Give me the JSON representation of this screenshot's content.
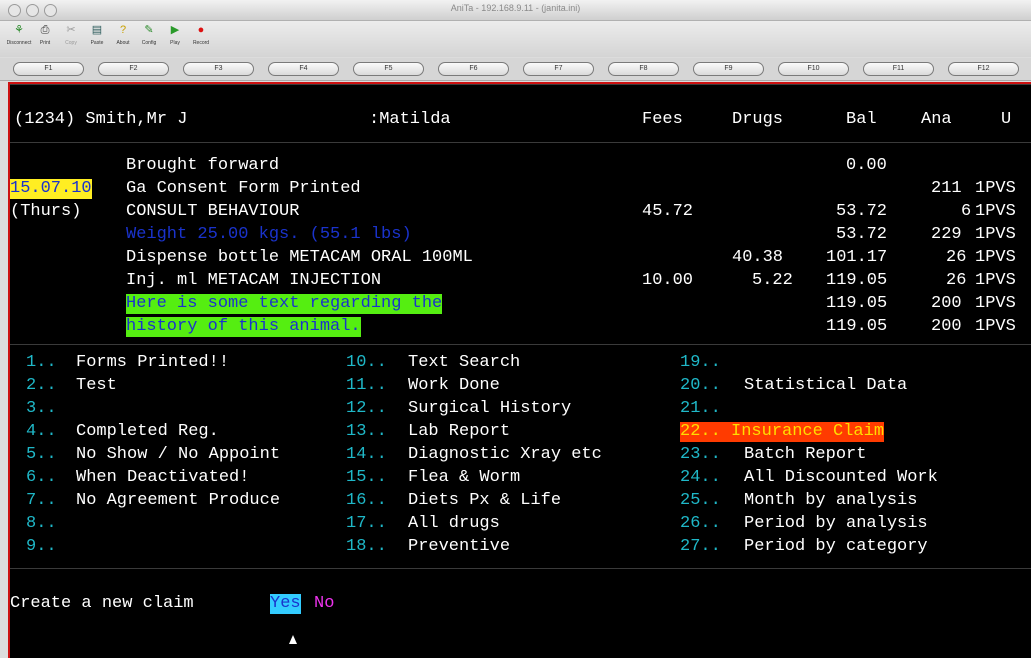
{
  "window": {
    "title": "AniTa - 192.168.9.11 - (janita.ini)"
  },
  "toolbar": [
    {
      "name": "disconnect",
      "label": "Disconnect",
      "icon": "⚘"
    },
    {
      "name": "print",
      "label": "Print",
      "icon": "⎙"
    },
    {
      "name": "copy",
      "label": "Copy",
      "icon": "✂"
    },
    {
      "name": "paste",
      "label": "Paste",
      "icon": "▤"
    },
    {
      "name": "about",
      "label": "About",
      "icon": "?"
    },
    {
      "name": "config",
      "label": "Config",
      "icon": "✎"
    },
    {
      "name": "play",
      "label": "Play",
      "icon": "▶"
    },
    {
      "name": "record",
      "label": "Record",
      "icon": "●"
    }
  ],
  "fkeys": [
    "F1",
    "F2",
    "F3",
    "F4",
    "F5",
    "F6",
    "F7",
    "F8",
    "F9",
    "F10",
    "F11",
    "F12"
  ],
  "header": {
    "patient": "(1234) Smith,Mr J",
    "animal": ":Matilda",
    "col_fees": "Fees",
    "col_drugs": "Drugs",
    "col_bal": "Bal",
    "col_ana": "Ana",
    "col_u": "U"
  },
  "history": {
    "date": "15.07.10",
    "day": "(Thurs)",
    "rows": [
      {
        "desc": "Brought forward",
        "fees": "",
        "drugs": "",
        "bal": "0.00",
        "ana": "",
        "u": ""
      },
      {
        "desc": "Ga Consent Form Printed",
        "fees": "",
        "drugs": "",
        "bal": "",
        "ana": "211",
        "u": "1PVS"
      },
      {
        "desc": "CONSULT BEHAVIOUR",
        "fees": "45.72",
        "drugs": "",
        "bal": "53.72",
        "ana": "6",
        "u": "1PVS"
      },
      {
        "desc": "Weight 25.00 kgs. (55.1 lbs)",
        "fees": "",
        "drugs": "",
        "bal": "53.72",
        "ana": "229",
        "u": "1PVS"
      },
      {
        "desc": "Dispense bottle METACAM ORAL 100ML",
        "fees": "",
        "drugs": "40.38",
        "bal": "101.17",
        "ana": "26",
        "u": "1PVS"
      },
      {
        "desc": "Inj. ml METACAM INJECTION",
        "fees": "10.00",
        "drugs": "5.22",
        "bal": "119.05",
        "ana": "26",
        "u": "1PVS"
      },
      {
        "desc": "Here is some text regarding the",
        "fees": "",
        "drugs": "",
        "bal": "119.05",
        "ana": "200",
        "u": "1PVS"
      },
      {
        "desc": "history of this animal.",
        "fees": "",
        "drugs": "",
        "bal": "119.05",
        "ana": "200",
        "u": "1PVS"
      }
    ]
  },
  "menu": [
    {
      "num": "1..",
      "label": "Forms Printed!!"
    },
    {
      "num": "2..",
      "label": "Test"
    },
    {
      "num": "3..",
      "label": ""
    },
    {
      "num": "4..",
      "label": "Completed Reg."
    },
    {
      "num": "5..",
      "label": "No Show / No Appoint"
    },
    {
      "num": "6..",
      "label": "When Deactivated!"
    },
    {
      "num": "7..",
      "label": "No Agreement Produce"
    },
    {
      "num": "8..",
      "label": ""
    },
    {
      "num": "9..",
      "label": ""
    },
    {
      "num": "10..",
      "label": "Text Search"
    },
    {
      "num": "11..",
      "label": "Work Done"
    },
    {
      "num": "12..",
      "label": "Surgical History"
    },
    {
      "num": "13..",
      "label": "Lab Report"
    },
    {
      "num": "14..",
      "label": "Diagnostic Xray etc"
    },
    {
      "num": "15..",
      "label": "Flea & Worm"
    },
    {
      "num": "16..",
      "label": "Diets Px & Life"
    },
    {
      "num": "17..",
      "label": "All drugs"
    },
    {
      "num": "18..",
      "label": "Preventive"
    },
    {
      "num": "19..",
      "label": ""
    },
    {
      "num": "20..",
      "label": "Statistical Data"
    },
    {
      "num": "21..",
      "label": ""
    },
    {
      "num": "22..",
      "label": "Insurance Claim"
    },
    {
      "num": "23..",
      "label": "Batch Report"
    },
    {
      "num": "24..",
      "label": "All Discounted Work"
    },
    {
      "num": "25..",
      "label": "Month by analysis"
    },
    {
      "num": "26..",
      "label": "Period by analysis"
    },
    {
      "num": "27..",
      "label": "Period by category"
    }
  ],
  "prompt": {
    "text": "Create a new claim",
    "yes": "Yes",
    "no": "No"
  },
  "colors": {
    "terminal_bg": "#000000",
    "border": "#cc1111",
    "menu_number": "#1fb8c8",
    "highlight_green": "#55ee11",
    "highlight_yellow": "#ffee22",
    "selected_menu": "#ff3b00",
    "yes_bg": "#33ccff"
  }
}
